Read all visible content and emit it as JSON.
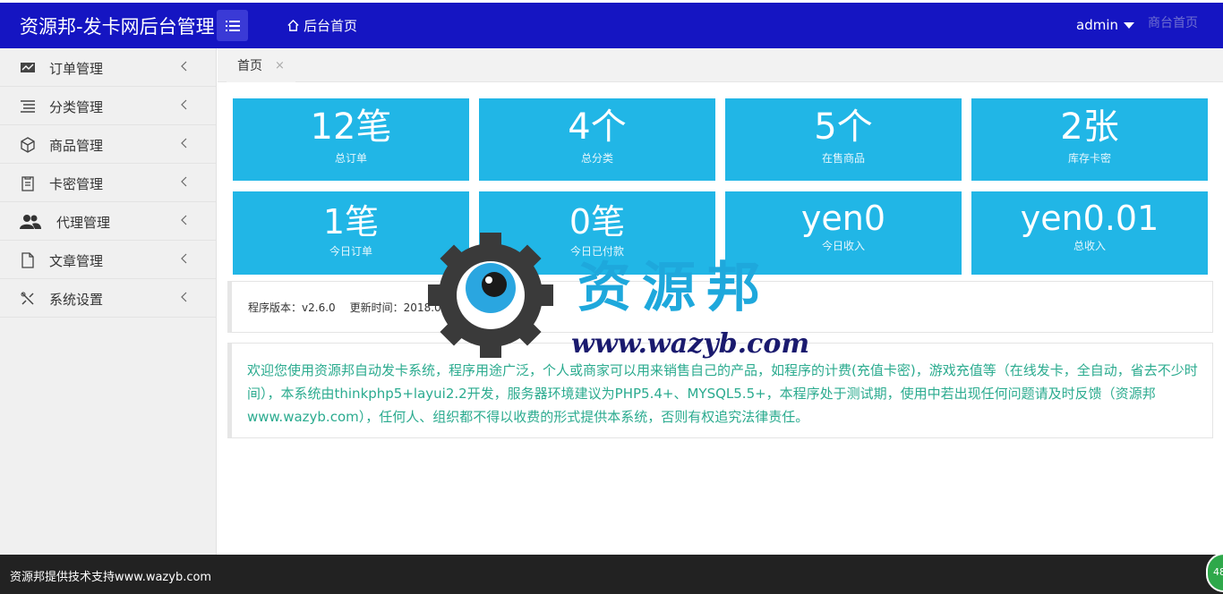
{
  "header": {
    "brand": "资源邦-发卡网后台管理",
    "home_label": "后台首页",
    "user_name": "admin",
    "ghost_link": "商台首页"
  },
  "sidebar": {
    "items": [
      {
        "label": "订单管理",
        "icon": "chart-icon"
      },
      {
        "label": "分类管理",
        "icon": "list-icon"
      },
      {
        "label": "商品管理",
        "icon": "box-icon"
      },
      {
        "label": "卡密管理",
        "icon": "clipboard-icon"
      },
      {
        "label": "代理管理",
        "icon": "users-icon"
      },
      {
        "label": "文章管理",
        "icon": "file-icon"
      },
      {
        "label": "系统设置",
        "icon": "tools-icon"
      }
    ]
  },
  "tabs": [
    {
      "label": "首页",
      "close": "×"
    }
  ],
  "stats": [
    {
      "value": "12笔",
      "label": "总订单"
    },
    {
      "value": "4个",
      "label": "总分类"
    },
    {
      "value": "5个",
      "label": "在售商品"
    },
    {
      "value": "2张",
      "label": "库存卡密"
    },
    {
      "value": "1笔",
      "label": "今日订单"
    },
    {
      "value": "0笔",
      "label": "今日已付款"
    },
    {
      "value": "yen0",
      "label": "今日收入"
    },
    {
      "value": "yen0.01",
      "label": "总收入"
    }
  ],
  "version": {
    "label": "程序版本：",
    "value": "v2.6.0",
    "updated_label": "更新时间：",
    "updated_value": "2018.01.20",
    "official": "官方网站"
  },
  "welcome_text": "欢迎您使用资源邦自动发卡系统，程序用途广泛，个人或商家可以用来销售自己的产品，如程序的计费(充值卡密)，游戏充值等（在线发卡，全自动，省去不少时间），本系统由thinkphp5+layui2.2开发，服务器环境建议为PHP5.4+、MYSQL5.5+，本程序处于测试期，使用中若出现任何问题请及时反馈（资源邦www.wazyb.com），任何人、组织都不得以收费的形式提供本系统，否则有权追究法律责任。",
  "watermark": {
    "title": "资源邦",
    "url": "www.wazyb.com"
  },
  "footer": {
    "text": "资源邦提供技术支持www.wazyb.com",
    "bubble": "48"
  },
  "colors": {
    "header": "#1515c2",
    "card": "#21b6e6",
    "welcome_text": "#2bab8f",
    "footer": "#222222"
  }
}
